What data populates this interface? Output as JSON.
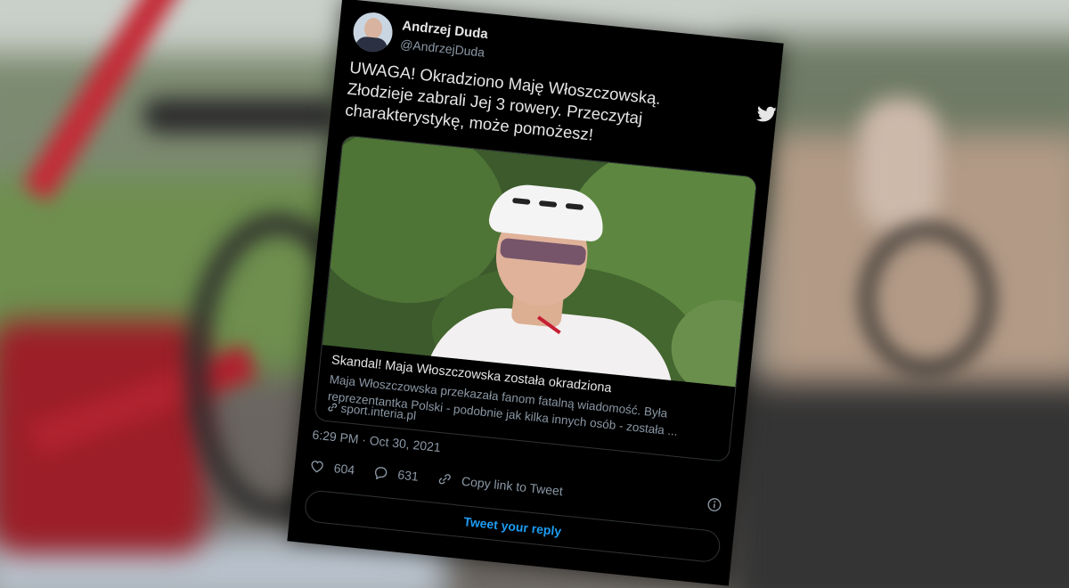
{
  "tweet": {
    "author_name": "Andrzej Duda",
    "author_handle": "@AndrzejDuda",
    "text": "UWAGA! Okradziono Maję Włoszczowską. Złodzieje zabrali Jej 3 rowery. Przeczytaj charakterystykę, może pomożesz!",
    "timestamp": "6:29 PM · Oct 30, 2021",
    "link_card": {
      "title": "Skandal! Maja Włoszczowska została okradziona",
      "description": "Maja Włoszczowska przekazała fanom fatalną wiadomość. Była reprezentantka Polski - podobnie jak kilka innych osób - została ...",
      "source": "sport.interia.pl"
    },
    "actions": {
      "likes": "604",
      "replies": "631",
      "copy_link_label": "Copy link to Tweet"
    },
    "reply_button_label": "Tweet your reply"
  },
  "icons": {
    "logo": "twitter-bird-icon",
    "like": "heart-icon",
    "reply": "speech-bubble-icon",
    "copy": "link-icon",
    "info": "info-icon"
  },
  "colors": {
    "card_background": "#000000",
    "accent": "#1d9bf0",
    "secondary_text": "#8b98a5"
  }
}
